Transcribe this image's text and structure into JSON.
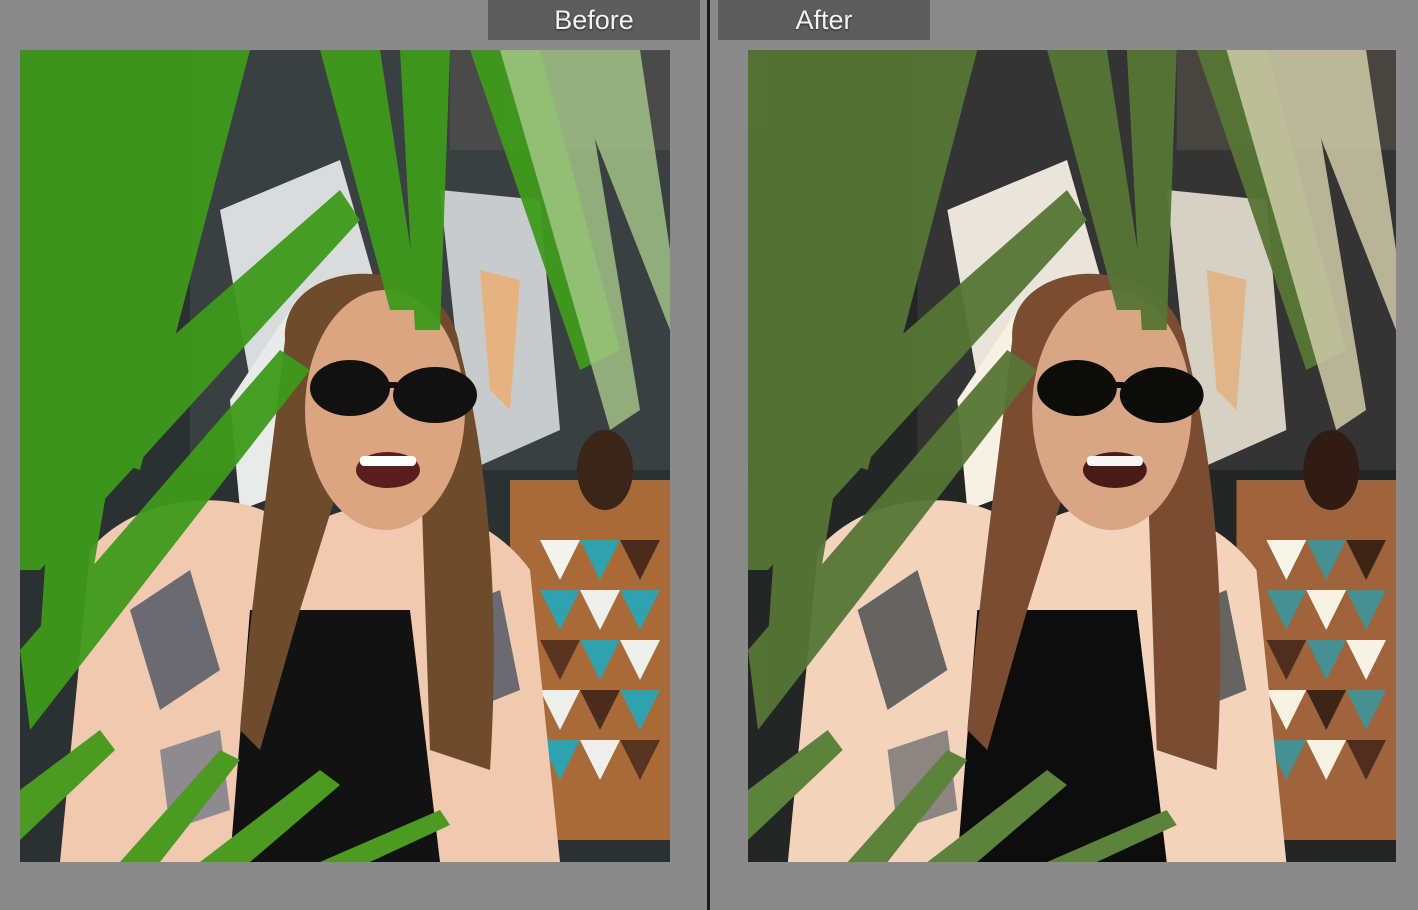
{
  "comparison": {
    "before_label": "Before",
    "after_label": "After"
  },
  "photos": {
    "before_icon": "photo-image",
    "after_icon": "photo-image"
  },
  "colors": {
    "background": "#8a8a8a",
    "label_tab": "#5d5d5d",
    "divider": "#1c1c1c"
  }
}
